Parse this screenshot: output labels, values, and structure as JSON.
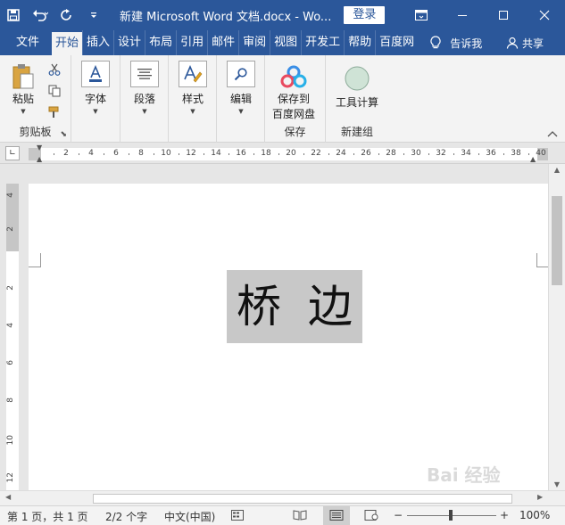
{
  "titlebar": {
    "title": "新建 Microsoft Word 文档.docx  -  Wo...",
    "login": "登录",
    "quick_access": [
      "save-icon",
      "undo-icon",
      "redo-icon",
      "customize-icon"
    ],
    "window_controls": [
      "ribbon-display-icon",
      "minimize-icon",
      "maximize-icon",
      "close-icon"
    ]
  },
  "tabs": [
    {
      "label": "文件"
    },
    {
      "label": "开始"
    },
    {
      "label": "插入"
    },
    {
      "label": "设计"
    },
    {
      "label": "布局"
    },
    {
      "label": "引用"
    },
    {
      "label": "邮件"
    },
    {
      "label": "审阅"
    },
    {
      "label": "视图"
    },
    {
      "label": "开发工"
    },
    {
      "label": "帮助"
    },
    {
      "label": "百度网"
    }
  ],
  "active_tab": "开始",
  "tell_me": "告诉我",
  "share": "共享",
  "ribbon": {
    "clipboard": {
      "paste": "粘贴",
      "label": "剪贴板"
    },
    "font": {
      "button": "字体"
    },
    "paragraph": {
      "button": "段落"
    },
    "styles": {
      "button": "样式"
    },
    "editing": {
      "button": "编辑"
    },
    "save": {
      "button_line1": "保存到",
      "button_line2": "百度网盘",
      "label": "保存"
    },
    "newgroup": {
      "button": "工具计算",
      "label": "新建组"
    }
  },
  "ruler": {
    "h_ticks": [
      "2",
      "4",
      "6",
      "8",
      "10",
      "12",
      "14",
      "16",
      "18",
      "20",
      "22",
      "24",
      "26",
      "28",
      "30",
      "32",
      "34",
      "36",
      "38",
      "40"
    ],
    "v_ticks_top": [
      "4",
      "2"
    ],
    "v_ticks_body": [
      "2",
      "4",
      "6",
      "8",
      "10",
      "12"
    ]
  },
  "document": {
    "text": "桥边"
  },
  "statusbar": {
    "page": "第 1 页，共 1 页",
    "words": "2/2 个字",
    "language": "中文(中国)",
    "zoom": "100%",
    "zoom_minus": "−",
    "zoom_plus": "+"
  },
  "watermark": "Bai 经验"
}
